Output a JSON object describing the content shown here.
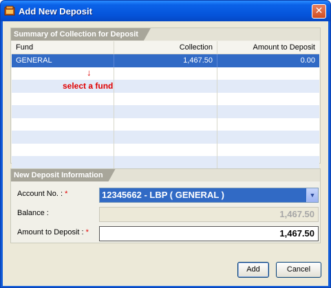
{
  "window": {
    "title": "Add New Deposit",
    "close_glyph": "✕"
  },
  "summary": {
    "header": "Summary of Collection for Deposit",
    "columns": [
      "Fund",
      "Collection",
      "Amount to Deposit"
    ],
    "rows": [
      {
        "fund": "GENERAL",
        "collection": "1,467.50",
        "amount": "0.00"
      }
    ],
    "annotation": "select a fund",
    "arrow_glyph": "↓"
  },
  "deposit_info": {
    "header": "New Deposit Information",
    "account_label": "Account No. :",
    "account_value": "12345662 - LBP  ( GENERAL )",
    "balance_label": "Balance :",
    "balance_value": "1,467.50",
    "amount_label": "Amount to Deposit :",
    "amount_value": "1,467.50",
    "required_marker": "*"
  },
  "buttons": {
    "add": "Add",
    "cancel": "Cancel"
  }
}
